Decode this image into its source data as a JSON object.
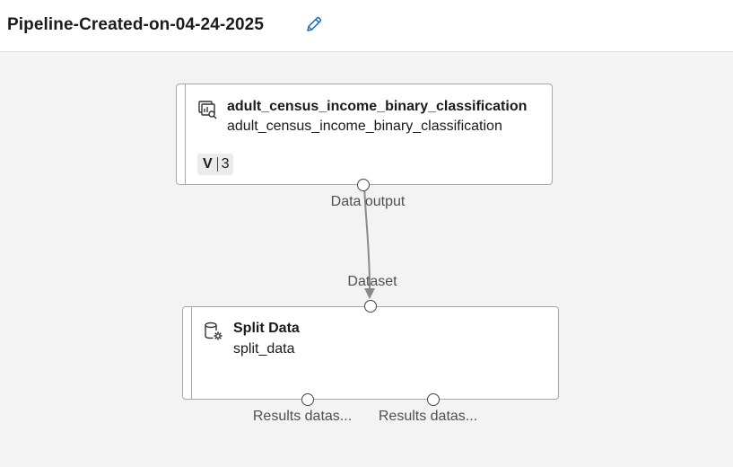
{
  "header": {
    "title": "Pipeline-Created-on-04-24-2025",
    "edit_icon": "pencil-icon"
  },
  "nodes": [
    {
      "id": "dataset-node",
      "icon": "dataset-icon",
      "title": "adult_census_income_binary_classification",
      "subtitle": "adult_census_income_binary_classification",
      "version_label": "V",
      "version_value": "3",
      "output_ports": [
        {
          "label": "Data output"
        }
      ]
    },
    {
      "id": "split-node",
      "icon": "split-data-icon",
      "title": "Split Data",
      "subtitle": "split_data",
      "input_ports": [
        {
          "label": "Dataset"
        }
      ],
      "output_ports": [
        {
          "label": "Results datas..."
        },
        {
          "label": "Results datas..."
        }
      ]
    }
  ],
  "colors": {
    "canvas_bg": "#f3f3f3",
    "accent": "#0f6cbd",
    "edge": "#8a8a8a"
  }
}
